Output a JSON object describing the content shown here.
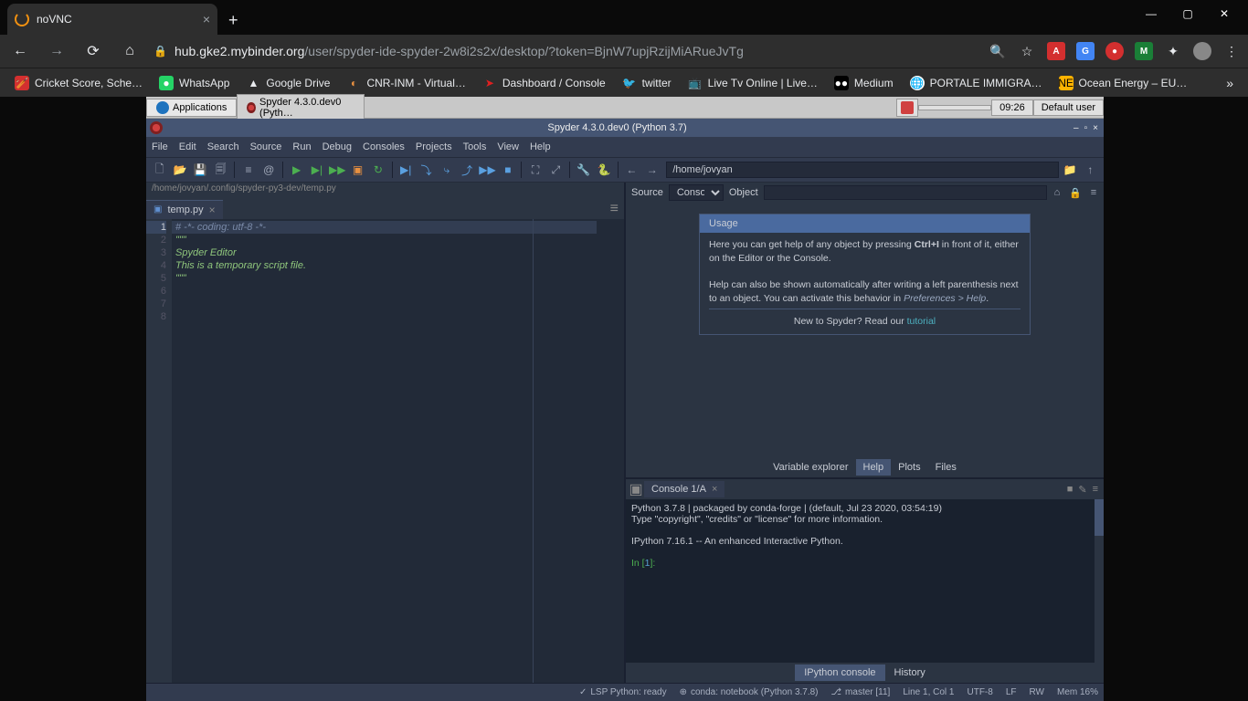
{
  "browser": {
    "tab_title": "noVNC",
    "url_host": "hub.gke2.mybinder.org",
    "url_path": "/user/spyder-ide-spyder-2w8i2s2x/desktop/?token=BjnW7upjRzijMiARueJvTg",
    "bookmarks": [
      "Cricket Score, Sche…",
      "WhatsApp",
      "Google Drive",
      "CNR-INM - Virtual…",
      "Dashboard / Console",
      "twitter",
      "Live Tv Online | Live…",
      "Medium",
      "PORTALE IMMIGRA…",
      "Ocean Energy – EU…"
    ]
  },
  "desktop": {
    "applications_label": "Applications",
    "taskbar_window": "Spyder 4.3.0.dev0 (Pyth…",
    "clock": "09:26",
    "user": "Default user"
  },
  "spyder": {
    "title": "Spyder 4.3.0.dev0 (Python 3.7)",
    "menu": [
      "File",
      "Edit",
      "Search",
      "Source",
      "Run",
      "Debug",
      "Consoles",
      "Projects",
      "Tools",
      "View",
      "Help"
    ],
    "cwd": "/home/jovyan",
    "editor": {
      "breadcrumb": "/home/jovyan/.config/spyder-py3-dev/temp.py",
      "tab": "temp.py",
      "lines": [
        "# -*- coding: utf-8 -*-",
        "\"\"\"",
        "Spyder Editor",
        "",
        "This is a temporary script file.",
        "\"\"\"",
        "",
        ""
      ]
    },
    "help": {
      "source_label": "Source",
      "source_value": "Console",
      "object_label": "Object",
      "object_value": "",
      "usage_title": "Usage",
      "usage_line1_pre": "Here you can get help of any object by pressing ",
      "usage_line1_kbd": "Ctrl+I",
      "usage_line1_post": " in front of it, either on the Editor or the Console.",
      "usage_line2_pre": "Help can also be shown automatically after writing a left parenthesis next to an object. You can activate this behavior in ",
      "usage_line2_em": "Preferences > Help",
      "usage_line2_post": ".",
      "tutorial_pre": "New to Spyder? Read our ",
      "tutorial_link": "tutorial",
      "tabs": [
        "Variable explorer",
        "Help",
        "Plots",
        "Files"
      ],
      "active_tab": "Help"
    },
    "console": {
      "tab": "Console 1/A",
      "out1": "Python 3.7.8 | packaged by conda-forge | (default, Jul 23 2020, 03:54:19)",
      "out2": "Type \"copyright\", \"credits\" or \"license\" for more information.",
      "out3": "IPython 7.16.1 -- An enhanced Interactive Python.",
      "prompt_pre": "In [",
      "prompt_num": "1",
      "prompt_post": "]:",
      "bottom_tabs": [
        "IPython console",
        "History"
      ]
    },
    "status": {
      "lsp": "LSP Python: ready",
      "conda": "conda: notebook (Python 3.7.8)",
      "git": "master [11]",
      "cursor": "Line 1, Col 1",
      "enc": "UTF-8",
      "eol": "LF",
      "perm": "RW",
      "mem": "Mem 16%"
    }
  }
}
